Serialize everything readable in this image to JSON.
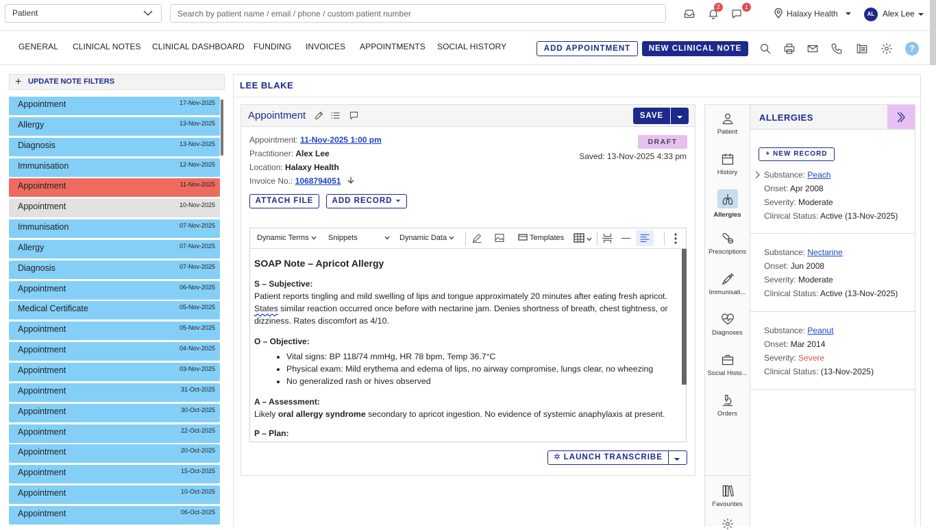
{
  "topbar": {
    "patient_select": "Patient",
    "search_placeholder": "Search by patient name / email / phone / custom patient number",
    "notification_count": "2",
    "message_count": "1",
    "location": "Halaxy Health",
    "avatar_initials": "AL",
    "user_name": "Alex Lee"
  },
  "nav": {
    "tabs": [
      "GENERAL",
      "CLINICAL NOTES",
      "CLINICAL DASHBOARD",
      "FUNDING",
      "INVOICES",
      "APPOINTMENTS",
      "SOCIAL HISTORY"
    ],
    "add_appointment": "ADD APPOINTMENT",
    "new_clinical_note": "NEW CLINICAL NOTE",
    "help": "?"
  },
  "filters": {
    "label": "UPDATE NOTE FILTERS"
  },
  "notes": [
    {
      "type": "Appointment",
      "date": "17-Nov-2025"
    },
    {
      "type": "Allergy",
      "date": "13-Nov-2025"
    },
    {
      "type": "Diagnosis",
      "date": "13-Nov-2025"
    },
    {
      "type": "Immunisation",
      "date": "12-Nov-2025"
    },
    {
      "type": "Appointment",
      "date": "11-Nov-2025"
    },
    {
      "type": "Appointment",
      "date": "10-Nov-2025"
    },
    {
      "type": "Immunisation",
      "date": "07-Nov-2025"
    },
    {
      "type": "Allergy",
      "date": "07-Nov-2025"
    },
    {
      "type": "Diagnosis",
      "date": "07-Nov-2025"
    },
    {
      "type": "Appointment",
      "date": "06-Nov-2025"
    },
    {
      "type": "Medical Certificate",
      "date": "05-Nov-2025"
    },
    {
      "type": "Appointment",
      "date": "05-Nov-2025"
    },
    {
      "type": "Appointment",
      "date": "04-Nov-2025"
    },
    {
      "type": "Appointment",
      "date": "03-Nov-2025"
    },
    {
      "type": "Appointment",
      "date": "31-Oct-2025"
    },
    {
      "type": "Appointment",
      "date": "30-Oct-2025"
    },
    {
      "type": "Appointment",
      "date": "22-Oct-2025"
    },
    {
      "type": "Appointment",
      "date": "20-Oct-2025"
    },
    {
      "type": "Appointment",
      "date": "15-Oct-2025"
    },
    {
      "type": "Appointment",
      "date": "10-Oct-2025"
    },
    {
      "type": "Appointment",
      "date": "06-Oct-2025"
    }
  ],
  "patient_name": "LEE BLAKE",
  "card": {
    "title": "Appointment",
    "save": "SAVE",
    "status": "DRAFT",
    "saved": "Saved: 13-Nov-2025 4:33 pm",
    "appointment_label": "Appointment:",
    "appointment_value": "11-Nov-2025 1:00 pm",
    "practitioner_label": "Practitioner:",
    "practitioner_value": "Alex Lee",
    "location_label": "Location:",
    "location_value": "Halaxy Health",
    "invoice_label": "Invoice No.:",
    "invoice_value": "1068794051",
    "attach_file": "ATTACH FILE",
    "add_record": "ADD RECORD",
    "launch_transcribe": "LAUNCH TRANSCRIBE"
  },
  "toolbar": {
    "dynamic_terms": "Dynamic Terms",
    "snippets": "Snippets",
    "dynamic_data": "Dynamic Data",
    "templates": "Templates"
  },
  "doc": {
    "title": "SOAP Note – Apricot Allergy",
    "s_heading": "S – Subjective:",
    "s_text_1": "Patient reports tingling and mild swelling of lips and tongue approximately 20 minutes after eating fresh apricot.",
    "s_text_2_word": "States",
    "s_text_2": " similar reaction occurred once before with nectarine jam. Denies shortness of breath, chest tightness, or dizziness. Rates discomfort as 4/10.",
    "o_heading": "O – Objective:",
    "o_items": [
      "Vital signs: BP 118/74 mmHg, HR 78 bpm, Temp 36.7°C",
      "Physical exam: Mild erythema and edema of lips, no airway compromise, lungs clear, no wheezing",
      "No generalized rash or hives observed"
    ],
    "a_heading": "A – Assessment:",
    "a_pre": "Likely ",
    "a_bold": "oral allergy syndrome",
    "a_post": " secondary to apricot ingestion. No evidence of systemic anaphylaxis at present.",
    "p_heading": "P – Plan:"
  },
  "sidebar": {
    "items": [
      "Patient",
      "History",
      "Allergies",
      "Prescriptions",
      "Immunisati...",
      "Diagnoses",
      "Social Histo...",
      "Orders",
      "Favourites"
    ]
  },
  "allergies": {
    "title": "ALLERGIES",
    "new_record": "+ NEW RECORD",
    "labels": {
      "substance": "Substance:",
      "onset": "Onset:",
      "severity": "Severity:",
      "clinical_status": "Clinical Status:"
    },
    "records": [
      {
        "substance": "Peach",
        "onset": "Apr 2008",
        "severity": "Moderate",
        "status": "Active (13-Nov-2025)"
      },
      {
        "substance": "Nectarine",
        "onset": "Jun 2008",
        "severity": "Moderate",
        "status": "Active (13-Nov-2025)"
      },
      {
        "substance": "Peanut",
        "onset": "Mar 2014",
        "severity": "Severe",
        "status": "(13-Nov-2025)"
      }
    ]
  },
  "colors": {
    "primary": "#1d2a8c",
    "note_blue": "#84cff7",
    "note_red": "#ee6b60",
    "draft": "#e7c0f2",
    "severe": "#e05050"
  }
}
